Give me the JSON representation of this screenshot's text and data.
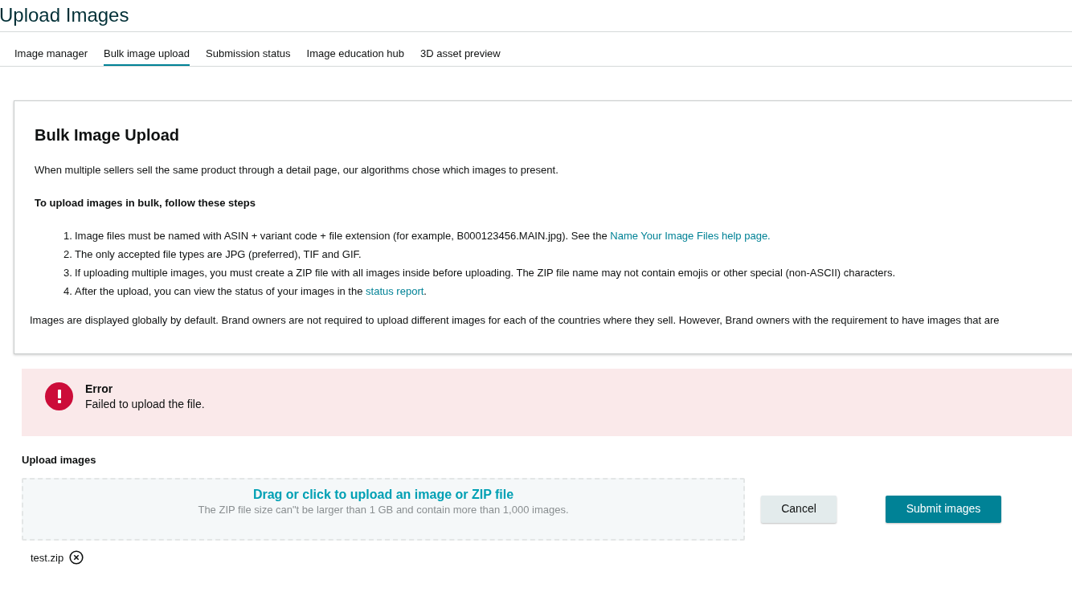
{
  "page_title": "Upload Images",
  "tabs": [
    {
      "label": "Image manager",
      "selected": false
    },
    {
      "label": "Bulk image upload",
      "selected": true
    },
    {
      "label": "Submission status",
      "selected": false
    },
    {
      "label": "Image education hub",
      "selected": false
    },
    {
      "label": "3D asset preview",
      "selected": false
    }
  ],
  "card": {
    "title": "Bulk Image Upload",
    "intro": "When multiple sellers sell the same product through a detail page, our algorithms chose which images to present.",
    "steps_heading": "To upload images in bulk, follow these steps",
    "steps": [
      {
        "number": "1.",
        "parts": [
          {
            "kind": "text",
            "text": "Image files must be named with ASIN + variant code + file extension (for example, B000123456.MAIN.jpg). See the"
          },
          {
            "kind": "link",
            "text": "Name Your Image Files help page."
          }
        ]
      },
      {
        "number": "2.",
        "parts": [
          {
            "kind": "text",
            "text": "The only accepted file types are JPG (preferred), TIF and GIF."
          }
        ]
      },
      {
        "number": "3.",
        "parts": [
          {
            "kind": "text",
            "text": "If uploading multiple images, you must create a ZIP file with all images inside before uploading. The ZIP file name may not contain emojis or other special (non-ASCII) characters."
          }
        ]
      },
      {
        "number": "4.",
        "parts": [
          {
            "kind": "text",
            "text": "After the upload, you can view the status of your images in the"
          },
          {
            "kind": "link",
            "text": "status report"
          },
          {
            "kind": "text",
            "text": "."
          }
        ]
      }
    ],
    "note": "Images are displayed globally by default. Brand owners are not required to upload different images for each of the countries where they sell. However, Brand owners with the requirement to have images that are"
  },
  "alert": {
    "kind": "error",
    "title": "Error",
    "message": "Failed to upload the file."
  },
  "upload": {
    "label": "Upload images",
    "drop_title": "Drag or click to upload an image or ZIP file",
    "drop_hint": "The ZIP file size can\"t be larger than 1 GB and contain more than 1,000 images.",
    "cancel": "Cancel",
    "submit": "Submit images",
    "file": "test.zip"
  }
}
